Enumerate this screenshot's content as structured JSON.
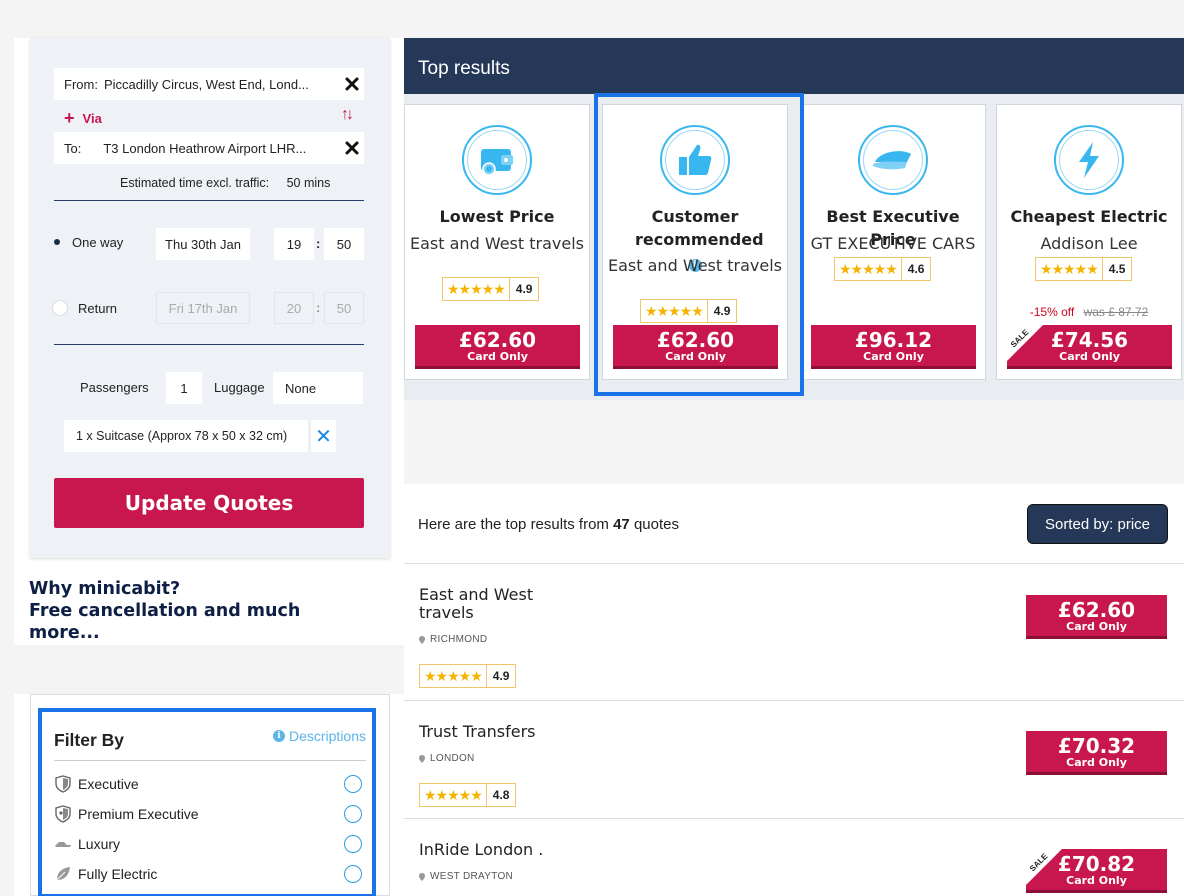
{
  "search": {
    "from_label": "From:",
    "from_value": "Piccadilly Circus, West End, Lond...",
    "via_label": "Via",
    "to_label": "To:",
    "to_value": "T3 London Heathrow Airport LHR...",
    "est_label": "Estimated time excl. traffic:",
    "est_value": "50 mins",
    "oneway_label": "One way",
    "oneway_date": "Thu 30th Jan",
    "oneway_hour": "19",
    "oneway_min": "50",
    "return_label": "Return",
    "return_date": "Fri 17th Jan",
    "return_hour": "20",
    "return_min": "50",
    "passengers_label": "Passengers",
    "passengers_value": "1",
    "luggage_label": "Luggage",
    "luggage_value": "None",
    "suitcase_value": "1 x Suitcase (Approx 78 x 50 x 32 cm)",
    "update_label": "Update Quotes"
  },
  "why": {
    "line1": "Why minicabit?",
    "line2": "Free cancellation and much more..."
  },
  "filter": {
    "title": "Filter By",
    "descriptions_label": "Descriptions",
    "items": [
      {
        "label": "Executive",
        "icon": "shield-icon"
      },
      {
        "label": "Premium Executive",
        "icon": "shield-icon"
      },
      {
        "label": "Luxury",
        "icon": "car-icon"
      },
      {
        "label": "Fully Electric",
        "icon": "leaf-icon"
      }
    ]
  },
  "top": {
    "header": "Top results",
    "cards": [
      {
        "title": "Lowest Price",
        "subtitle": "East and West travels",
        "rating": "4.9",
        "price": "£62.60",
        "price_note": "Card Only",
        "icon": "wallet-icon"
      },
      {
        "title": "Customer recommended",
        "subtitle": "East and West travels",
        "rating": "4.9",
        "price": "£62.60",
        "price_note": "Card Only",
        "icon": "thumbs-up-icon"
      },
      {
        "title": "Best Executive Price",
        "subtitle": "GT EXECUTIVE CARS",
        "rating": "4.6",
        "price": "£96.12",
        "price_note": "Card Only",
        "icon": "chauffeur-cap-icon"
      },
      {
        "title": "Cheapest Electric",
        "subtitle": "Addison Lee",
        "rating": "4.5",
        "price": "£74.56",
        "price_note": "Card Only",
        "icon": "lightning-icon",
        "discount": "-15% off",
        "was": "was £ 87.72",
        "sale": "SALE"
      }
    ]
  },
  "results": {
    "text_prefix": "Here are the top results from",
    "count": "47",
    "text_suffix": "quotes",
    "sort_label": "Sorted by: price",
    "rows": [
      {
        "name": "East and West travels",
        "location": "RICHMOND",
        "rating": "4.9",
        "price": "£62.60",
        "price_note": "Card Only"
      },
      {
        "name": "Trust Transfers",
        "location": "LONDON",
        "rating": "4.8",
        "price": "£70.32",
        "price_note": "Card Only"
      },
      {
        "name": "InRide London .",
        "location": "WEST DRAYTON",
        "price": "£70.82",
        "price_note": "Card Only",
        "sale": "SALE"
      }
    ]
  },
  "colors": {
    "accent": "#c8174f",
    "navy": "#253858",
    "highlight": "#1a73e8",
    "icon_blue": "#38b6ef"
  }
}
